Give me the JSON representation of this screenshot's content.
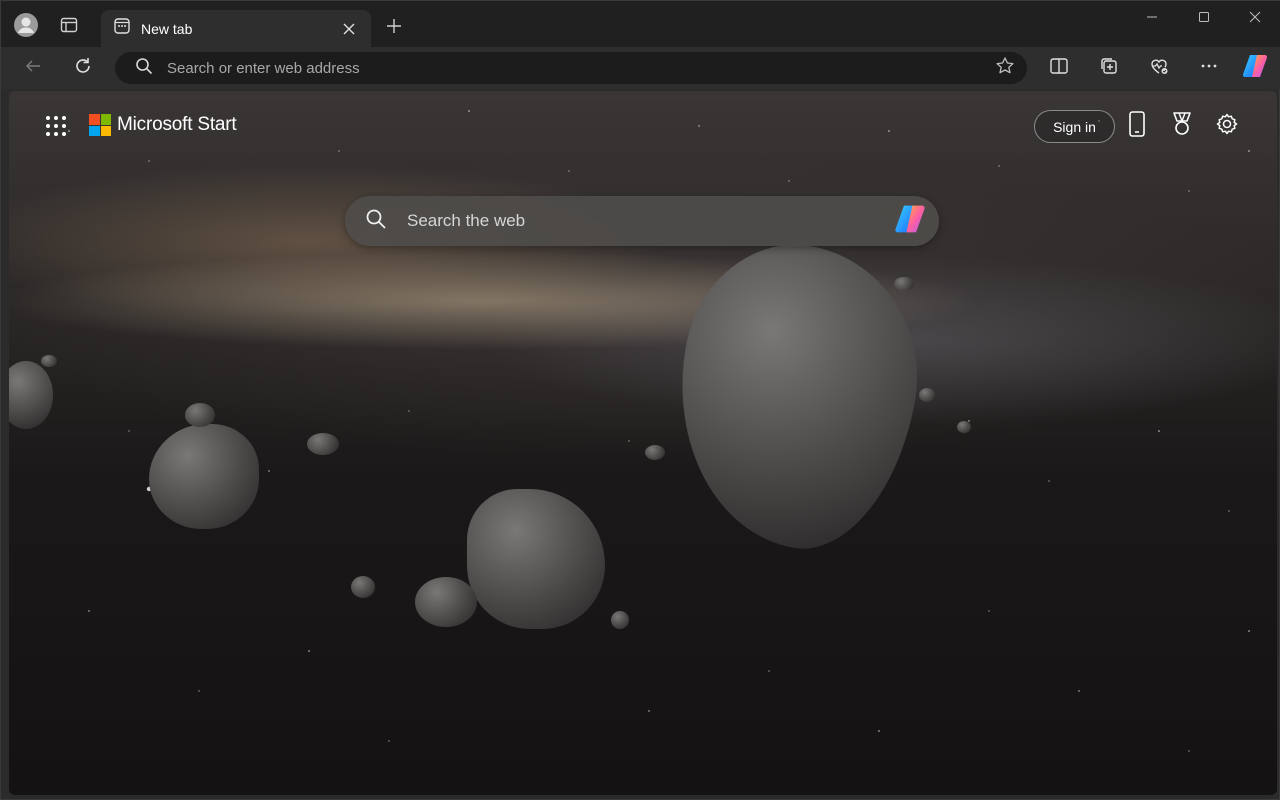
{
  "tab": {
    "title": "New tab"
  },
  "omnibox": {
    "placeholder": "Search or enter web address"
  },
  "start": {
    "brand": "Microsoft Start",
    "sign_in": "Sign in",
    "search_placeholder": "Search the web",
    "logo_colors": [
      "#f25022",
      "#7fba00",
      "#00a4ef",
      "#ffb900"
    ]
  },
  "icons": {
    "profile": "profile-icon",
    "workspaces": "workspaces-icon",
    "new_tab_page": "new-tab-page-icon",
    "close_tab": "close-icon",
    "new_tab": "plus-icon",
    "minimize": "minimize-icon",
    "maximize": "maximize-icon",
    "close_window": "close-icon",
    "back": "back-arrow-icon",
    "refresh": "refresh-icon",
    "search": "search-icon",
    "favorite": "star-icon",
    "split_screen": "split-screen-icon",
    "collections": "collections-icon",
    "browser_essentials": "heart-pulse-icon",
    "more": "more-icon",
    "copilot": "copilot-icon",
    "apps": "app-launcher-icon",
    "phone": "phone-icon",
    "rewards": "rewards-icon",
    "settings": "gear-icon"
  }
}
